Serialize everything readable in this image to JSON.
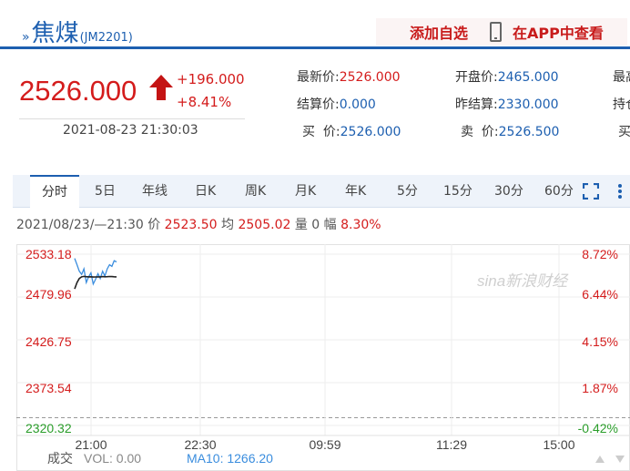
{
  "header": {
    "title": "焦煤",
    "code": "(JM2201)",
    "add_watchlist": "添加自选",
    "view_in_app": "在APP中查看"
  },
  "quote": {
    "price": "2526.000",
    "change": "+196.000",
    "change_pct": "+8.41%",
    "datetime": "2021-08-23 21:30:03",
    "fields": [
      {
        "label": "最新价:",
        "value": "2526.000",
        "color": "red"
      },
      {
        "label": "开盘价:",
        "value": "2465.000",
        "color": "blue"
      },
      {
        "label": "最高",
        "value": "",
        "color": "blue"
      },
      {
        "label": "结算价:",
        "value": "0.000",
        "color": "blue"
      },
      {
        "label": "昨结算:",
        "value": "2330.000",
        "color": "blue"
      },
      {
        "label": "持仓",
        "value": "",
        "color": "blue"
      },
      {
        "label": "买  价:",
        "value": "2526.000",
        "color": "blue"
      },
      {
        "label": "卖  价:",
        "value": "2526.500",
        "color": "blue"
      },
      {
        "label": "买",
        "value": "",
        "color": "blue"
      }
    ]
  },
  "tabs": [
    "分时",
    "5日",
    "年线",
    "日K",
    "周K",
    "月K",
    "年K",
    "5分",
    "15分",
    "30分",
    "60分"
  ],
  "info": {
    "datetime": "2021/08/23/—21:30",
    "price_label": "价",
    "price": "2523.50",
    "avg_label": "均",
    "avg": "2505.02",
    "vol_label": "量",
    "vol": "0",
    "amp_label": "幅",
    "amp": "8.30%"
  },
  "chart_data": {
    "type": "line",
    "y_ticks": [
      "2533.18",
      "2479.96",
      "2426.75",
      "2373.54",
      "2320.32"
    ],
    "y_ticks_right": [
      "8.72%",
      "6.44%",
      "4.15%",
      "1.87%",
      "-0.42%"
    ],
    "x_ticks": [
      "21:00",
      "22:30",
      "09:59",
      "11:29",
      "15:00"
    ],
    "ylim": [
      2320.32,
      2533.18
    ],
    "reference_price": 2330.0,
    "series": [
      {
        "values": [
          2528,
          2520,
          2512,
          2508,
          2515,
          2498,
          2505,
          2510,
          2496,
          2502,
          2509,
          2503,
          2512,
          2506,
          2515,
          2520,
          2518,
          2525,
          2523.5
        ],
        "color": "#3a8dde"
      },
      {
        "values": [
          2490,
          2498,
          2503,
          2505,
          2505.5,
          2505.2,
          2505,
          2505.1,
          2504.8,
          2504.9,
          2505,
          2505.02,
          2505.3,
          2505.1,
          2505.2,
          2505.4,
          2505.3,
          2505.1,
          2505.02
        ],
        "color": "#222222"
      }
    ],
    "footer": {
      "vol_label": "成交",
      "vol_text": "VOL: 0.00",
      "ma_text": "MA10: 1266.20"
    },
    "watermark": "sina新浪财经"
  },
  "colors": {
    "accent": "#1d5fb0",
    "up": "#d41c1c"
  }
}
